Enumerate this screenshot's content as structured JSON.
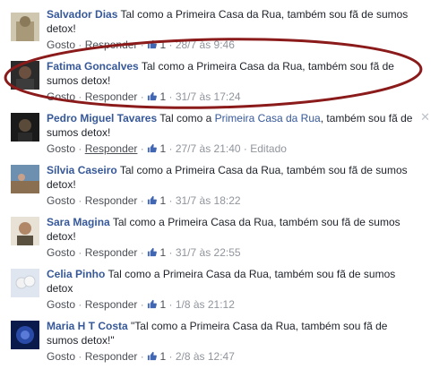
{
  "comment_text": "Tal como a Primeira Casa da Rua, também sou fã de sumos detox!",
  "actions": {
    "like": "Gosto",
    "reply": "Responder",
    "sep": "·",
    "edited": "Editado"
  },
  "comments": [
    {
      "author": "Salvador Dias",
      "line1": "Tal como a Primeira Casa da Rua, também sou fã de sumos",
      "line2": "detox!",
      "likes": "1",
      "date": "28/7 às 9:46"
    },
    {
      "author": "Fatima Goncalves",
      "line1": "Tal como a Primeira Casa da Rua, também sou fã de",
      "line2": "sumos detox!",
      "likes": "1",
      "date": "31/7 às 17:24"
    },
    {
      "author": "Pedro Miguel Tavares",
      "pre": "Tal como a ",
      "link": "Primeira Casa da Rua",
      "post": ", também sou fã de",
      "line2": "sumos detox!",
      "likes": "1",
      "date": "27/7 às 21:40"
    },
    {
      "author": "Sílvia Caseiro",
      "line1": "Tal como a Primeira Casa da Rua, também sou fã de sumos",
      "line2": "detox!",
      "likes": "1",
      "date": "31/7 às 18:22"
    },
    {
      "author": "Sara Magina",
      "line1": "Tal como a Primeira Casa da Rua, também sou fã de sumos",
      "line2": "detox!",
      "likes": "1",
      "date": "31/7 às 22:55"
    },
    {
      "author": "Celia Pinho",
      "line1": "Tal como a Primeira Casa da Rua, também sou fã de sumos",
      "line2": "detox",
      "likes": "1",
      "date": "1/8 às 21:12"
    },
    {
      "author": "Maria H T Costa",
      "line1": "\"Tal como a Primeira Casa da Rua, também sou fã de",
      "line2": "sumos detox!\"",
      "likes": "1",
      "date": "2/8 às 12:47"
    }
  ],
  "colors": {
    "author": "#365899",
    "highlight_ellipse": "#8b1a1a"
  },
  "icons": {
    "like": "thumbs-up-icon",
    "close": "close-icon"
  }
}
